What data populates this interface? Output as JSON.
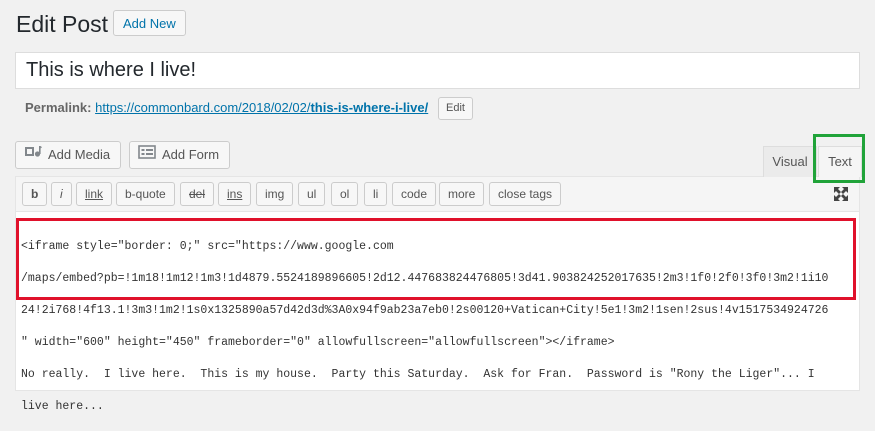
{
  "header": {
    "title": "Edit Post",
    "add_new_label": "Add New"
  },
  "post": {
    "title": "This is where I live!"
  },
  "permalink": {
    "label": "Permalink:",
    "url_base": "https://commonbard.com/2018/02/02/",
    "slug": "this-is-where-i-live/",
    "edit_label": "Edit"
  },
  "media": {
    "add_media_label": "Add Media",
    "add_form_label": "Add Form"
  },
  "tabs": {
    "visual": "Visual",
    "text": "Text",
    "active": "Text"
  },
  "toolbar": {
    "buttons": [
      "b",
      "i",
      "link",
      "b-quote",
      "del",
      "ins",
      "img",
      "ul",
      "ol",
      "li",
      "code",
      "more",
      "close tags"
    ]
  },
  "content": {
    "lines": [
      "<iframe style=\"border: 0;\" src=\"https://www.google.com",
      "/maps/embed?pb=!1m18!1m12!1m3!1d4879.5524189896605!2d12.447683824476805!3d41.903824252017635!2m3!1f0!2f0!3f0!3m2!1i10",
      "24!2i768!4f13.1!3m3!1m2!1s0x1325890a57d42d3d%3A0x94f9ab23a7eb0!2s00120+Vatican+City!5e1!3m2!1sen!2sus!4v1517534924726",
      "\" width=\"600\" height=\"450\" frameborder=\"0\" allowfullscreen=\"allowfullscreen\"></iframe>",
      "No really.  I live here.  This is my house.  Party this Saturday.  Ask for Fran.  Password is \"Rony the Liger\"... I",
      "live here..."
    ]
  },
  "colors": {
    "highlight_red": "#e0112b",
    "highlight_green": "#20a339",
    "link": "#0073aa"
  }
}
